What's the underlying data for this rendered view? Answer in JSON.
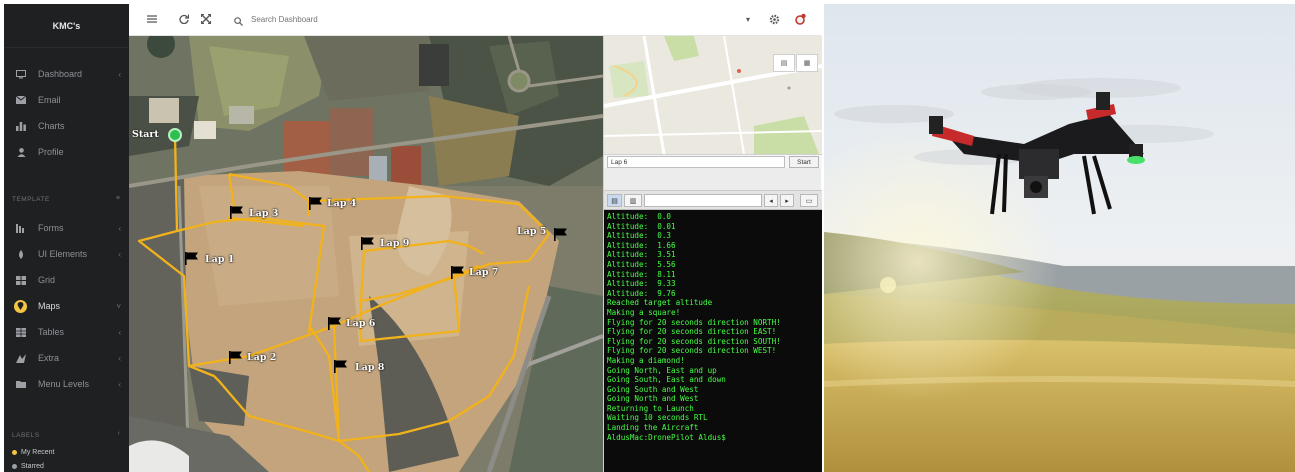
{
  "sidebar": {
    "brand": "KMC's",
    "items": [
      {
        "label": "Dashboard",
        "icon": "monitor-icon",
        "caret": true
      },
      {
        "label": "Email",
        "icon": "envelope-icon",
        "caret": false
      },
      {
        "label": "Charts",
        "icon": "bar-chart-icon",
        "caret": false
      },
      {
        "label": "Profile",
        "icon": "user-icon",
        "caret": false
      }
    ],
    "template_label": "TEMPLATE",
    "template_items": [
      {
        "label": "Forms",
        "icon": "forms-icon",
        "caret": true
      },
      {
        "label": "UI Elements",
        "icon": "ui-elements-icon",
        "caret": true
      },
      {
        "label": "Grid",
        "icon": "grid-icon",
        "caret": false
      },
      {
        "label": "Maps",
        "icon": "map-marker-icon",
        "caret": true,
        "active": true
      },
      {
        "label": "Tables",
        "icon": "table-icon",
        "caret": true
      },
      {
        "label": "Extra",
        "icon": "extra-icon",
        "caret": true
      },
      {
        "label": "Menu Levels",
        "icon": "folder-icon",
        "caret": true
      }
    ],
    "labels_label": "LABELS",
    "labels": [
      {
        "label": "My Recent",
        "color": "#f4c542"
      },
      {
        "label": "Starred",
        "color": "#9aa0a6"
      }
    ]
  },
  "topbar": {
    "menu_icon": "hamburger-icon",
    "refresh_icon": "refresh-icon",
    "expand_icon": "expand-icon",
    "search_placeholder": "Search Dashboard",
    "settings_icon": "gear-icon",
    "notification_icon": "notification-icon"
  },
  "map": {
    "start_label": "Start",
    "route_color": "#f2b21b",
    "laps": [
      {
        "label": "Lap 1"
      },
      {
        "label": "Lap 2"
      },
      {
        "label": "Lap 3"
      },
      {
        "label": "Lap 4"
      },
      {
        "label": "Lap 5"
      },
      {
        "label": "Lap 6"
      },
      {
        "label": "Lap 7"
      },
      {
        "label": "Lap 8"
      },
      {
        "label": "Lap 9"
      }
    ]
  },
  "mission": {
    "lap_value": "Lap 6",
    "start_button": "Start"
  },
  "terminal": {
    "lines": [
      "Altitude:  0.0",
      "Altitude:  0.01",
      "Altitude:  0.3",
      "Altitude:  1.66",
      "Altitude:  3.51",
      "Altitude:  5.56",
      "Altitude:  8.11",
      "Altitude:  9.33",
      "Altitude:  9.76",
      "Reached target altitude",
      "Making a square!",
      "Flying for 20 seconds direction NORTH!",
      "Flying for 20 seconds direction EAST!",
      "Flying for 20 seconds direction SOUTH!",
      "Flying for 20 seconds direction WEST!",
      "Making a diamond!",
      "Going North, East and up",
      "Going South, East and down",
      "Going South and West",
      "Going North and West",
      "Returning to Launch",
      "Waiting 10 seconds RTL",
      "Landing the Aircraft",
      "AldusMac:DronePilot Aldus$"
    ]
  }
}
